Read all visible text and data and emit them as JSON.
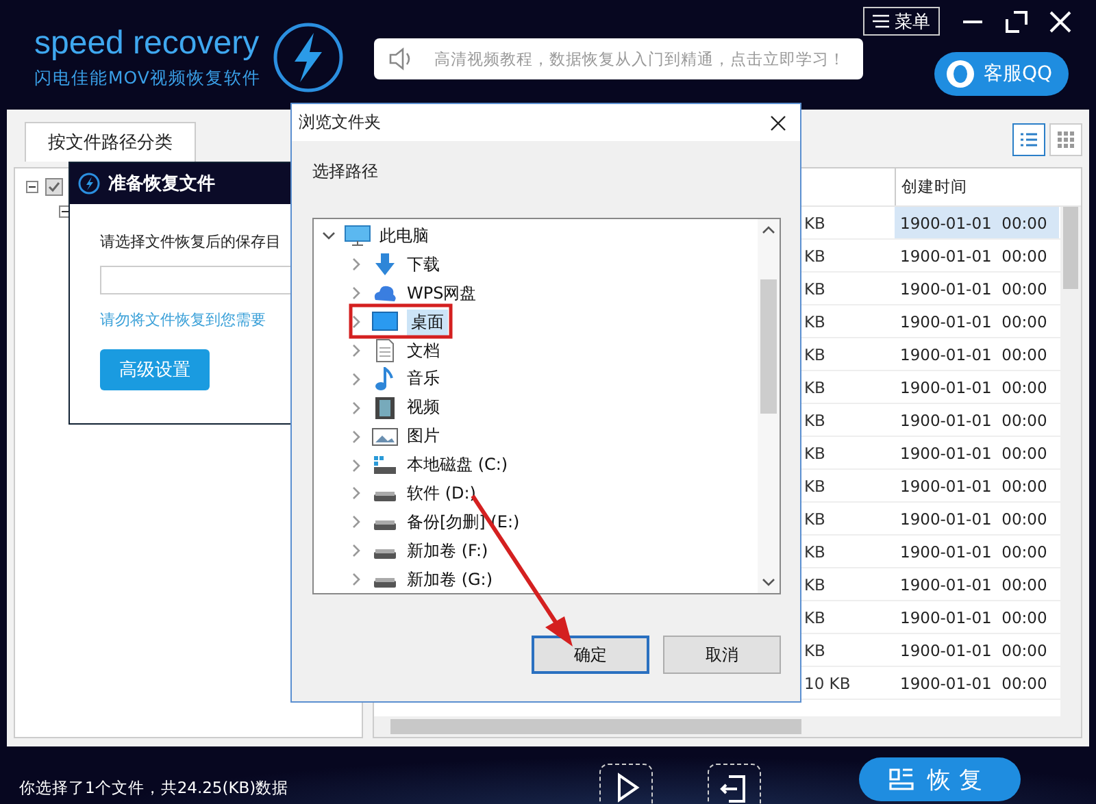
{
  "header": {
    "logo": "speed recovery",
    "subtitle": "闪电佳能MOV视频恢复软件",
    "notice": "高清视频教程，数据恢复从入门到精通，点击立即学习！",
    "menu_button": "菜单",
    "support_button": "客服QQ"
  },
  "tabs": [
    {
      "label": "按文件路径分类",
      "selected": true
    }
  ],
  "view_modes": [
    {
      "kind": "list",
      "selected": true
    },
    {
      "kind": "grid",
      "selected": false
    }
  ],
  "file_tree": {
    "root_checked": true
  },
  "table": {
    "columns": [
      "创建时间"
    ],
    "rows": [
      {
        "size": "KB",
        "created": "1900-01-01  00:00",
        "selected": true
      },
      {
        "size": "KB",
        "created": "1900-01-01  00:00",
        "selected": false
      },
      {
        "size": "KB",
        "created": "1900-01-01  00:00",
        "selected": false
      },
      {
        "size": "KB",
        "created": "1900-01-01  00:00",
        "selected": false
      },
      {
        "size": "KB",
        "created": "1900-01-01  00:00",
        "selected": false
      },
      {
        "size": "KB",
        "created": "1900-01-01  00:00",
        "selected": false
      },
      {
        "size": "KB",
        "created": "1900-01-01  00:00",
        "selected": false
      },
      {
        "size": "KB",
        "created": "1900-01-01  00:00",
        "selected": false
      },
      {
        "size": "KB",
        "created": "1900-01-01  00:00",
        "selected": false
      },
      {
        "size": "KB",
        "created": "1900-01-01  00:00",
        "selected": false
      },
      {
        "size": "KB",
        "created": "1900-01-01  00:00",
        "selected": false
      },
      {
        "size": "KB",
        "created": "1900-01-01  00:00",
        "selected": false
      },
      {
        "size": "KB",
        "created": "1900-01-01  00:00",
        "selected": false
      },
      {
        "size": "KB",
        "created": "1900-01-01  00:00",
        "selected": false
      },
      {
        "size": "10 KB",
        "created": "1900-01-01  00:00",
        "selected": false
      }
    ]
  },
  "status": "你选择了1个文件，共24.25(KB)数据",
  "recover_button": "恢复",
  "prepare_dialog": {
    "title": "准备恢复文件",
    "prompt": "请选择文件恢复后的保存目",
    "warning": "请勿将文件恢复到您需要",
    "advanced_button": "高级设置"
  },
  "browse_dialog": {
    "title": "浏览文件夹",
    "label": "选择路径",
    "tree": [
      {
        "label": "此电脑",
        "kind": "computer",
        "expanded": true,
        "selected": false,
        "children": [
          {
            "label": "下载",
            "kind": "download",
            "expanded": false,
            "selected": false
          },
          {
            "label": "WPS网盘",
            "kind": "cloud",
            "expanded": false,
            "selected": false
          },
          {
            "label": "桌面",
            "kind": "desktop",
            "expanded": false,
            "selected": true
          },
          {
            "label": "文档",
            "kind": "document",
            "expanded": false,
            "selected": false
          },
          {
            "label": "音乐",
            "kind": "music",
            "expanded": false,
            "selected": false
          },
          {
            "label": "视频",
            "kind": "video",
            "expanded": false,
            "selected": false
          },
          {
            "label": "图片",
            "kind": "picture",
            "expanded": false,
            "selected": false
          },
          {
            "label": "本地磁盘 (C:)",
            "kind": "system-drive",
            "expanded": false,
            "selected": false
          },
          {
            "label": "软件 (D:)",
            "kind": "drive",
            "expanded": false,
            "selected": false
          },
          {
            "label": "备份[勿删] (E:)",
            "kind": "drive",
            "expanded": false,
            "selected": false
          },
          {
            "label": "新加卷 (F:)",
            "kind": "drive",
            "expanded": false,
            "selected": false
          },
          {
            "label": "新加卷 (G:)",
            "kind": "drive",
            "expanded": false,
            "selected": false
          }
        ]
      }
    ],
    "buttons": [
      {
        "label": "确定",
        "default": true
      },
      {
        "label": "取消",
        "default": false
      }
    ]
  }
}
